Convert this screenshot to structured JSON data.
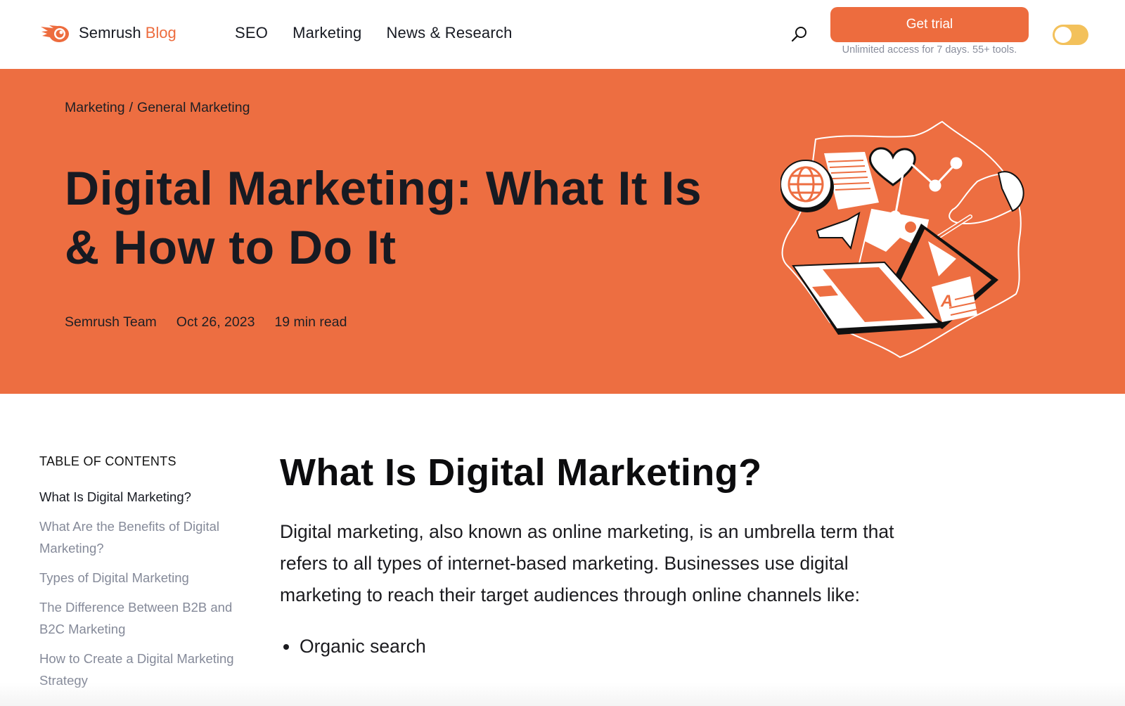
{
  "header": {
    "logo_brand": "Semrush",
    "logo_section": "Blog",
    "nav": [
      {
        "label": "SEO"
      },
      {
        "label": "Marketing"
      },
      {
        "label": "News & Research"
      }
    ],
    "search_icon": "search-icon",
    "trial_button": "Get trial",
    "trial_subtext": "Unlimited access for 7 days. 55+ tools.",
    "theme_toggle": {
      "state": "off",
      "icon": "toggle-switch"
    }
  },
  "hero": {
    "breadcrumb": [
      {
        "label": "Marketing"
      },
      {
        "label": "General Marketing"
      }
    ],
    "breadcrumb_separator": "/",
    "title": "Digital Marketing: What It Is & How to Do It",
    "author": "Semrush Team",
    "date": "Oct 26, 2023",
    "read_time": "19 min read",
    "illustration": "digital-marketing-illustration (laptop, globe, heart, chart, documents, hand with pen)"
  },
  "toc": {
    "heading": "TABLE OF CONTENTS",
    "items": [
      {
        "label": "What Is Digital Marketing?",
        "active": true
      },
      {
        "label": "What Are the Benefits of Digital Marketing?",
        "active": false
      },
      {
        "label": "Types of Digital Marketing",
        "active": false
      },
      {
        "label": "The Difference Between B2B and B2C Marketing",
        "active": false
      },
      {
        "label": "How to Create a Digital Marketing Strategy",
        "active": false
      }
    ]
  },
  "article": {
    "heading": "What Is Digital Marketing?",
    "paragraph": "Digital marketing, also known as online marketing, is an umbrella term that refers to all types of internet-based marketing. Businesses use digital marketing to reach their target audiences through online channels like:",
    "list": [
      "Organic search"
    ]
  },
  "colors": {
    "brand_orange": "#ed6e41",
    "button_orange": "#ed6c3e",
    "toggle_yellow": "#f3c15b",
    "text_dark": "#171a22",
    "text_muted": "#858a99"
  }
}
